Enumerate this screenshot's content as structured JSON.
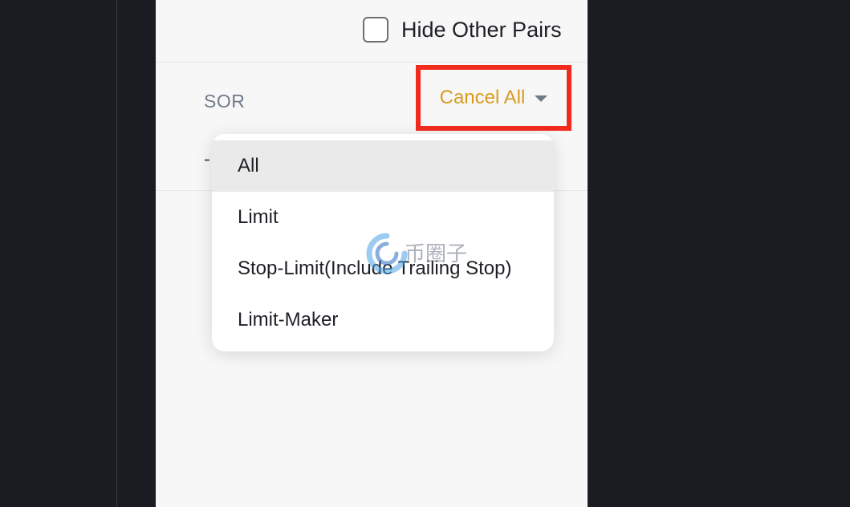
{
  "filter": {
    "hide_other_pairs_label": "Hide Other Pairs",
    "hide_other_pairs_checked": false
  },
  "orders_header": {
    "sor_label": "SOR",
    "cancel_all_label": "Cancel All",
    "empty_value": "-"
  },
  "cancel_all_menu": {
    "items": [
      {
        "label": "All",
        "selected": true
      },
      {
        "label": "Limit",
        "selected": false
      },
      {
        "label": "Stop-Limit(Include Trailing Stop)",
        "selected": false
      },
      {
        "label": "Limit-Maker",
        "selected": false
      }
    ]
  },
  "watermark": {
    "text": "币圈子"
  },
  "colors": {
    "accent": "#d89b1f",
    "highlight_box": "#f12b1e",
    "dark_background": "#1b1c22",
    "panel_background": "#f7f7f7",
    "selected_item": "#eaeaea"
  }
}
